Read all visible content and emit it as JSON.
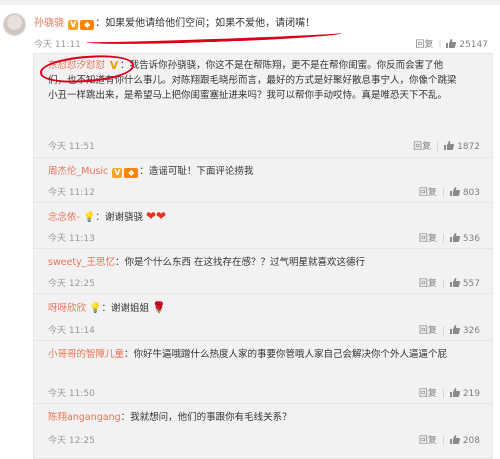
{
  "main_comment": {
    "username": "孙骁骁",
    "text": "如果爱他请给他们空间；如果不爱他，请闭嘴！",
    "time": "今天 11:11",
    "reply_label": "回复",
    "like_count": "25147"
  },
  "replies": [
    {
      "username": "东怼怼汐怼怼",
      "text": "我告诉你孙骁骁，你这不是在帮陈翔，更不是在帮你闺蜜。你反而会害了他们，也不知道有你什么事儿。对陈翔跟毛晓彤而言，最好的方式是好聚好散息事宁人，你像个跳梁小丑一样跳出来，是希望马上把你闺蜜塞扯进来吗？我可以帮你手动哎恃。真是唯恐天下不乱。",
      "time": "今天 11:51",
      "reply_label": "回复",
      "like_count": "1872"
    },
    {
      "username": "周杰伦_Music",
      "text": "造谣可耻！下面评论捞我",
      "time": "今天 11:12",
      "reply_label": "回复",
      "like_count": "803"
    },
    {
      "username": "念念依-",
      "text": "谢谢骁骁",
      "time": "今天 11:13",
      "reply_label": "回复",
      "like_count": "536"
    },
    {
      "username": "sweety_王思忆",
      "text": "你是个什么东西 在这找存在感？？过气明星就喜欢这德行",
      "time": "今天 12:25",
      "reply_label": "回复",
      "like_count": "557"
    },
    {
      "username": "呀呀欣欣",
      "text": "谢谢姐姐",
      "time": "今天 11:14",
      "reply_label": "回复",
      "like_count": "326"
    },
    {
      "username": "小哥哥的智障儿童",
      "text": "你好牛逼哦蹭什么热度人家的事要你管哦人家自己会解决你个外人逼逼个屁",
      "time": "今天 11:50",
      "reply_label": "回复",
      "like_count": "219"
    },
    {
      "username": "陈翔angangang",
      "text": "我就想问，他们的事跟你有毛线关系？",
      "time": "今天 12:25",
      "reply_label": "回复",
      "like_count": "208"
    }
  ],
  "colors": {
    "username": "#eb7350",
    "annotation_red": "#d9001b",
    "panel_bg": "#f2f2f5"
  }
}
